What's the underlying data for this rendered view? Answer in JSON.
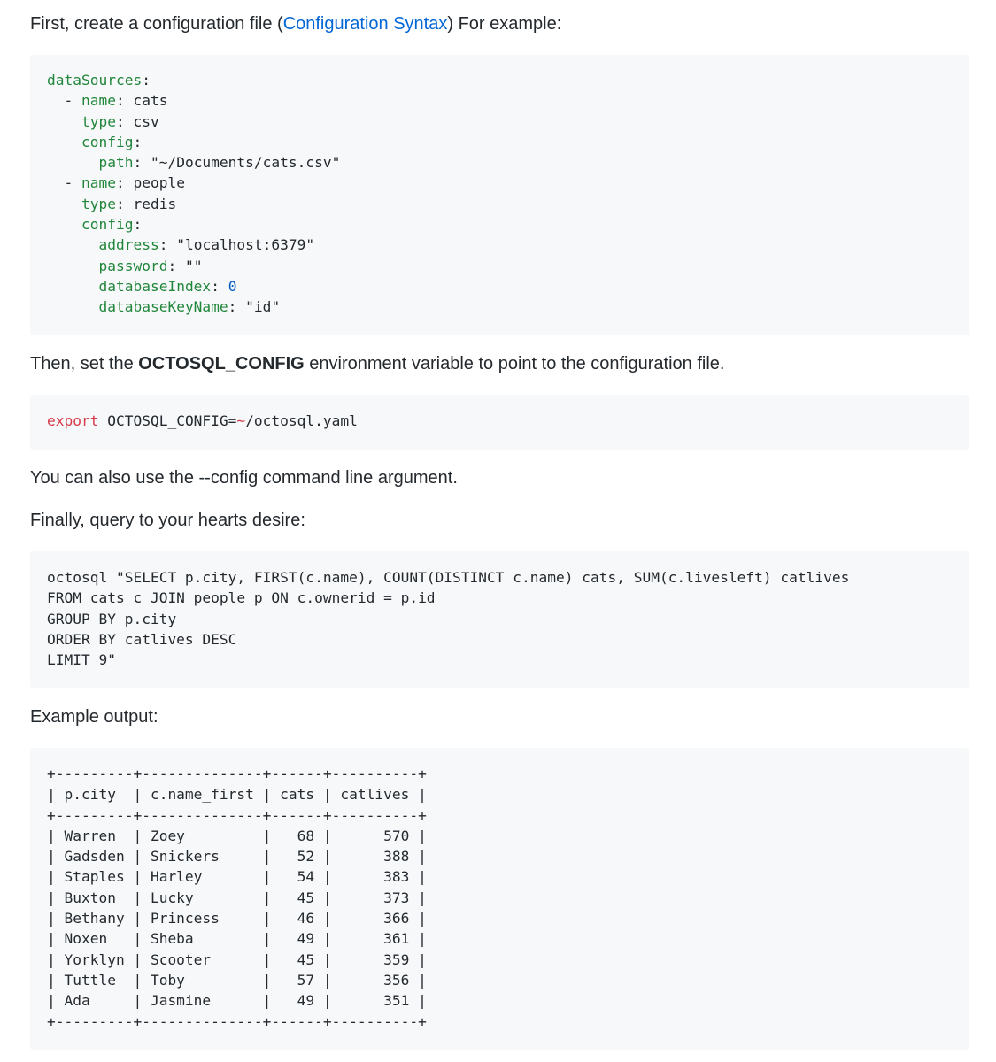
{
  "intro": {
    "before": "First, create a configuration file (",
    "link": "Configuration Syntax",
    "after": ") For example:"
  },
  "yaml": {
    "l1_key": "dataSources",
    "l1_colon": ":",
    "l2_dash": "  - ",
    "l2_key": "name",
    "l2_val": ": cats",
    "l3_pad": "    ",
    "l3_key": "type",
    "l3_val": ": csv",
    "l4_pad": "    ",
    "l4_key": "config",
    "l4_colon": ":",
    "l5_pad": "      ",
    "l5_key": "path",
    "l5_val": ": \"~/Documents/cats.csv\"",
    "l6_dash": "  - ",
    "l6_key": "name",
    "l6_val": ": people",
    "l7_pad": "    ",
    "l7_key": "type",
    "l7_val": ": redis",
    "l8_pad": "    ",
    "l8_key": "config",
    "l8_colon": ":",
    "l9_pad": "      ",
    "l9_key": "address",
    "l9_val": ": \"localhost:6379\"",
    "l10_pad": "      ",
    "l10_key": "password",
    "l10_val": ": \"\"",
    "l11_pad": "      ",
    "l11_key": "databaseIndex",
    "l11_sep": ": ",
    "l11_num": "0",
    "l12_pad": "      ",
    "l12_key": "databaseKeyName",
    "l12_val": ": \"id\""
  },
  "env": {
    "before": "Then, set the ",
    "strong": "OCTOSQL_CONFIG",
    "after": " environment variable to point to the configuration file."
  },
  "export_cmd": {
    "keyword": "export",
    "mid": " OCTOSQL_CONFIG=",
    "tilde": "~",
    "path": "/octosql.yaml"
  },
  "config_arg": "You can also use the --config command line argument.",
  "finally": "Finally, query to your hearts desire:",
  "query_lines": [
    "octosql \"SELECT p.city, FIRST(c.name), COUNT(DISTINCT c.name) cats, SUM(c.livesleft) catlives",
    "FROM cats c JOIN people p ON c.ownerid = p.id",
    "GROUP BY p.city",
    "ORDER BY catlives DESC",
    "LIMIT 9\""
  ],
  "output_label": "Example output:",
  "output_lines": [
    "+---------+--------------+------+----------+",
    "| p.city  | c.name_first | cats | catlives |",
    "+---------+--------------+------+----------+",
    "| Warren  | Zoey         |   68 |      570 |",
    "| Gadsden | Snickers     |   52 |      388 |",
    "| Staples | Harley       |   54 |      383 |",
    "| Buxton  | Lucky        |   45 |      373 |",
    "| Bethany | Princess     |   46 |      366 |",
    "| Noxen   | Sheba        |   49 |      361 |",
    "| Yorklyn | Scooter      |   45 |      359 |",
    "| Tuttle  | Toby         |   57 |      356 |",
    "| Ada     | Jasmine      |   49 |      351 |",
    "+---------+--------------+------+----------+"
  ]
}
